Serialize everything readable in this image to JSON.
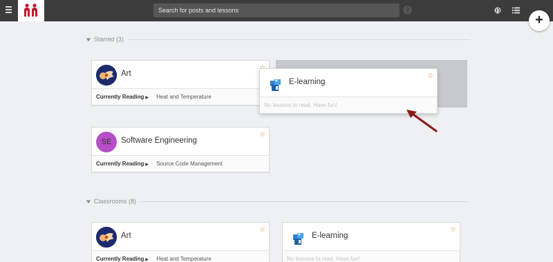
{
  "topbar": {
    "search_placeholder": "Search for posts and lessons",
    "help_label": "?",
    "add_label": "+"
  },
  "icons": {
    "menu": "hamburger-icon",
    "logo": "brand-logo",
    "help": "help-icon",
    "globe": "globe-icon",
    "list": "list-icon",
    "add": "plus-icon",
    "star": "star-icon",
    "chevron": "chevron-down-icon"
  },
  "colors": {
    "topbar": "#3c3c3c",
    "brand_red": "#c01a2b",
    "star": "#d9822b",
    "background": "#eef0f3",
    "arrow": "#8b1a1a"
  },
  "starred": {
    "label": "Starred (3)",
    "cards": [
      {
        "title": "Art",
        "reading_label": "Currently Reading",
        "reading_value": "Heat and Temperature"
      },
      {
        "title": "E-learning",
        "empty_text": "No lessons to read. Have fun!"
      },
      {
        "title": "Software Engineering",
        "initials": "SE",
        "reading_label": "Currently Reading",
        "reading_value": "Source Code Management"
      }
    ]
  },
  "classrooms": {
    "label": "Classrooms (8)",
    "cards": [
      {
        "title": "Art",
        "reading_label": "Currently Reading",
        "reading_value": "Heat and Temperature"
      },
      {
        "title": "E-learning",
        "empty_text": "No lessons to read. Have fun!"
      }
    ]
  }
}
